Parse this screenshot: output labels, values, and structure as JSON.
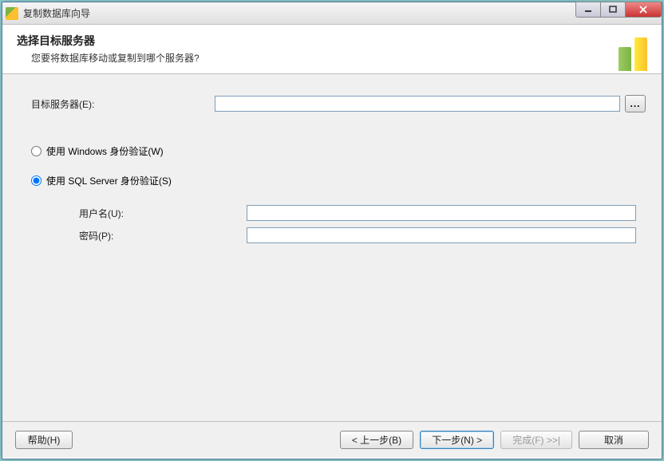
{
  "window": {
    "title": "复制数据库向导"
  },
  "header": {
    "title": "选择目标服务器",
    "subtitle": "您要将数据库移动或复制到哪个服务器?"
  },
  "form": {
    "dest_server_label": "目标服务器(E):",
    "dest_server_value": "",
    "browse_label": "...",
    "auth_windows_label": "使用 Windows 身份验证(W)",
    "auth_sql_label": "使用 SQL Server 身份验证(S)",
    "auth_selected": "sql",
    "username_label": "用户名(U):",
    "username_value": "",
    "password_label": "密码(P):",
    "password_value": ""
  },
  "footer": {
    "help": "帮助(H)",
    "back": "< 上一步(B)",
    "next": "下一步(N) >",
    "finish": "完成(F) >>|",
    "cancel": "取消"
  }
}
